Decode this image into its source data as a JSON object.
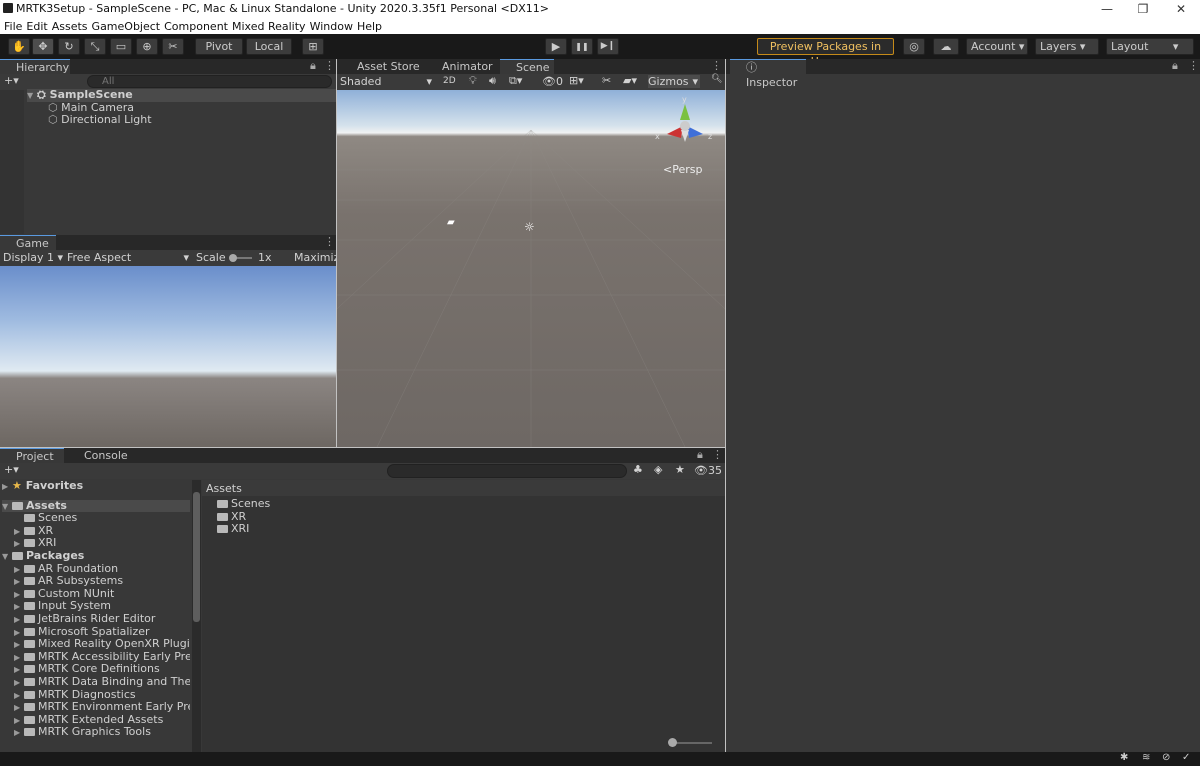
{
  "title": "MRTK3Setup - SampleScene - PC, Mac & Linux Standalone - Unity 2020.3.35f1 Personal <DX11>",
  "window_controls": {
    "minimize": "—",
    "restore": "❐",
    "close": "✕"
  },
  "menu": [
    "File",
    "Edit",
    "Assets",
    "GameObject",
    "Component",
    "Mixed Reality",
    "Window",
    "Help"
  ],
  "toolbar": {
    "pivot": "Pivot",
    "local": "Local",
    "preview": "Preview Packages in Use ▾",
    "account": "Account",
    "layers": "Layers",
    "layout": "Layout",
    "play": "▶",
    "pause": "❚❚",
    "step": "▶❙"
  },
  "hierarchy": {
    "tab": "Hierarchy",
    "search_placeholder": "All",
    "scene": "SampleScene",
    "items": [
      "Main Camera",
      "Directional Light"
    ]
  },
  "game": {
    "tab": "Game",
    "display": "Display 1",
    "aspect": "Free Aspect",
    "scale_label": "Scale",
    "scale_value": "1x",
    "maximize": "Maximize"
  },
  "scene_tabs": {
    "asset_store": "Asset Store",
    "animator": "Animator",
    "scene": "Scene"
  },
  "scene_bar": {
    "shading": "Shaded",
    "mode2d": "2D",
    "hidden_count": "0",
    "gizmos": "Gizmos",
    "persp": "Persp",
    "axis_x": "x",
    "axis_y": "y",
    "axis_z": "z"
  },
  "inspector": {
    "tab": "Inspector"
  },
  "project": {
    "tab": "Project",
    "console": "Console",
    "hidden_count": "35",
    "favorites": "Favorites",
    "assets": "Assets",
    "asset_children": [
      "Scenes",
      "XR",
      "XRI"
    ],
    "packages": "Packages",
    "package_items": [
      "AR Foundation",
      "AR Subsystems",
      "Custom NUnit",
      "Input System",
      "JetBrains Rider Editor",
      "Microsoft Spatializer",
      "Mixed Reality OpenXR Plugin",
      "MRTK Accessibility Early Preview",
      "MRTK Core Definitions",
      "MRTK Data Binding and Theming",
      "MRTK Diagnostics",
      "MRTK Environment Early Preview",
      "MRTK Extended Assets",
      "MRTK Graphics Tools"
    ],
    "breadcrumb": "Assets",
    "content": [
      "Scenes",
      "XR",
      "XRI"
    ]
  }
}
